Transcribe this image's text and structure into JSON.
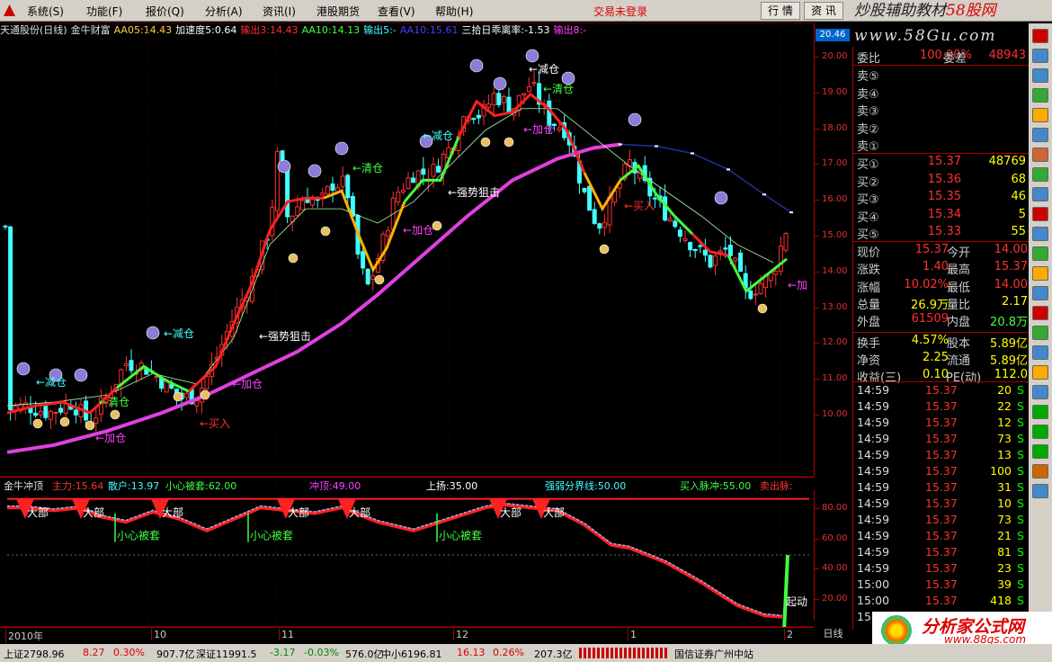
{
  "menu": {
    "items": [
      "系统(S)",
      "功能(F)",
      "报价(Q)",
      "分析(A)",
      "资讯(I)",
      "港股期货",
      "查看(V)",
      "帮助(H)"
    ],
    "status": "交易未登录",
    "btn_quote": "行 情",
    "btn_news": "资 讯",
    "watermark_main": "炒股辅助教材",
    "watermark_site": "58股网",
    "watermark_url": "www.58Gu.com"
  },
  "main_header": [
    {
      "text": "天通股份(日线)",
      "color": "#e0e0e0"
    },
    {
      "text": "金牛财富",
      "color": "#e0e0e0"
    },
    {
      "text": "AA05:14.43",
      "color": "#ffd040"
    },
    {
      "text": "加速度5:0.64",
      "color": "#ffffff"
    },
    {
      "text": "输出3:14.43",
      "color": "#ff3030"
    },
    {
      "text": "AA10:14.13",
      "color": "#40ff40"
    },
    {
      "text": "输出5:-",
      "color": "#40ffff"
    },
    {
      "text": "AA10:15.61",
      "color": "#4040ff"
    },
    {
      "text": "三拾日乖离率:-1.53",
      "color": "#ffffff"
    },
    {
      "text": "输出8:-",
      "color": "#ff40ff"
    }
  ],
  "current_price_label": "20.46",
  "price_axis": [
    "20.00",
    "19.00",
    "18.00",
    "17.00",
    "16.00",
    "15.00",
    "14.00",
    "13.00",
    "12.00",
    "11.00",
    "10.00"
  ],
  "sub_header": [
    {
      "text": "金牛冲顶",
      "color": "#e0e0e0"
    },
    {
      "text": "主力:15.64",
      "color": "#ff3030"
    },
    {
      "text": "散户:13.97",
      "color": "#40ffff"
    },
    {
      "text": "小心被套:62.00",
      "color": "#40ff40"
    },
    {
      "text": "冲顶:49.00",
      "color": "#ff40ff"
    },
    {
      "text": "上扬:35.00",
      "color": "#ffffff"
    },
    {
      "text": "强弱分界线:50.00",
      "color": "#40ffff"
    },
    {
      "text": "买入脉冲:55.00",
      "color": "#40ff40"
    },
    {
      "text": "卖出脉:",
      "color": "#ff3030"
    }
  ],
  "sub_axis": [
    "80.00",
    "60.00",
    "40.00",
    "20.00"
  ],
  "date_axis": [
    "2010年",
    "10",
    "11",
    "12",
    "1",
    "2"
  ],
  "day_label": "日线",
  "chart_annotations": {
    "reduce": "减仓",
    "clear": "清仓",
    "add": "加仓",
    "buy": "买入",
    "strong_snipe": "强势狙击",
    "top": "大部",
    "trap": "小心被套",
    "start": "起动",
    "add_short": "加"
  },
  "order_book": {
    "ratio": {
      "label": "委比",
      "pct": "100.00%",
      "diff_label": "委差",
      "diff": "48943"
    },
    "sells": [
      {
        "label": "卖⑤",
        "price": "",
        "vol": ""
      },
      {
        "label": "卖④",
        "price": "",
        "vol": ""
      },
      {
        "label": "卖③",
        "price": "",
        "vol": ""
      },
      {
        "label": "卖②",
        "price": "",
        "vol": ""
      },
      {
        "label": "卖①",
        "price": "",
        "vol": ""
      }
    ],
    "buys": [
      {
        "label": "买①",
        "price": "15.37",
        "vol": "48769"
      },
      {
        "label": "买②",
        "price": "15.36",
        "vol": "68"
      },
      {
        "label": "买③",
        "price": "15.35",
        "vol": "46"
      },
      {
        "label": "买④",
        "price": "15.34",
        "vol": "5"
      },
      {
        "label": "买⑤",
        "price": "15.33",
        "vol": "55"
      }
    ]
  },
  "quote_stats": [
    {
      "a": "现价",
      "b": "15.37",
      "bc": "#ff3030",
      "c": "今开",
      "d": "14.00",
      "dc": "#ff3030"
    },
    {
      "a": "涨跌",
      "b": "1.40",
      "bc": "#ff3030",
      "c": "最高",
      "d": "15.37",
      "dc": "#ff3030"
    },
    {
      "a": "涨幅",
      "b": "10.02%",
      "bc": "#ff3030",
      "c": "最低",
      "d": "14.00",
      "dc": "#ff3030"
    },
    {
      "a": "总量",
      "b": "26.9万",
      "bc": "#ffff00",
      "c": "量比",
      "d": "2.17",
      "dc": "#ffff00"
    },
    {
      "a": "外盘",
      "b": "61509",
      "bc": "#ff3030",
      "c": "内盘",
      "d": "20.8万",
      "dc": "#40ff40"
    },
    {
      "a": "换手",
      "b": "4.57%",
      "bc": "#ffff00",
      "c": "股本",
      "d": "5.89亿",
      "dc": "#ffff00"
    },
    {
      "a": "净资",
      "b": "2.25",
      "bc": "#ffff00",
      "c": "流通",
      "d": "5.89亿",
      "dc": "#ffff00"
    },
    {
      "a": "收益(三)",
      "b": "0.10",
      "bc": "#ffff00",
      "c": "PE(动)",
      "d": "112.0",
      "dc": "#ffff00"
    }
  ],
  "ticks": [
    {
      "time": "14:59",
      "price": "15.37",
      "vol": "20",
      "side": "S"
    },
    {
      "time": "14:59",
      "price": "15.37",
      "vol": "22",
      "side": "S"
    },
    {
      "time": "14:59",
      "price": "15.37",
      "vol": "12",
      "side": "S"
    },
    {
      "time": "14:59",
      "price": "15.37",
      "vol": "73",
      "side": "S"
    },
    {
      "time": "14:59",
      "price": "15.37",
      "vol": "13",
      "side": "S"
    },
    {
      "time": "14:59",
      "price": "15.37",
      "vol": "100",
      "side": "S"
    },
    {
      "time": "14:59",
      "price": "15.37",
      "vol": "31",
      "side": "S"
    },
    {
      "time": "14:59",
      "price": "15.37",
      "vol": "10",
      "side": "S"
    },
    {
      "time": "14:59",
      "price": "15.37",
      "vol": "73",
      "side": "S"
    },
    {
      "time": "14:59",
      "price": "15.37",
      "vol": "21",
      "side": "S"
    },
    {
      "time": "14:59",
      "price": "15.37",
      "vol": "81",
      "side": "S"
    },
    {
      "time": "14:59",
      "price": "15.37",
      "vol": "23",
      "side": "S"
    },
    {
      "time": "15:00",
      "price": "15.37",
      "vol": "39",
      "side": "S"
    },
    {
      "time": "15:00",
      "price": "15.37",
      "vol": "418",
      "side": "S"
    },
    {
      "time": "15",
      "price": "",
      "vol": "",
      "side": ""
    }
  ],
  "status_bar": {
    "sh": "上证2798.96",
    "sh_chg": "8.27",
    "sh_pct": "0.30%",
    "sh_amt": "907.7亿",
    "sz": "深证11991.5",
    "sz_chg": "-3.17",
    "sz_pct": "-0.03%",
    "sz_amt": "576.0亿",
    "zx": "中小6196.81",
    "zx_chg": "16.13",
    "zx_pct": "0.26%",
    "zx_amt": "207.3亿",
    "broker": "国信证券广州中站"
  },
  "brand": {
    "name": "分析家公式网",
    "url": "www.88gs.com"
  },
  "colors": {
    "up": "#ff3030",
    "down": "#40ffff",
    "ma_magenta": "#e040e0",
    "ma_green": "#40ff40",
    "ma_gold": "#ffb000",
    "ma_blue": "#2030a0",
    "axis": "#aa0000"
  }
}
